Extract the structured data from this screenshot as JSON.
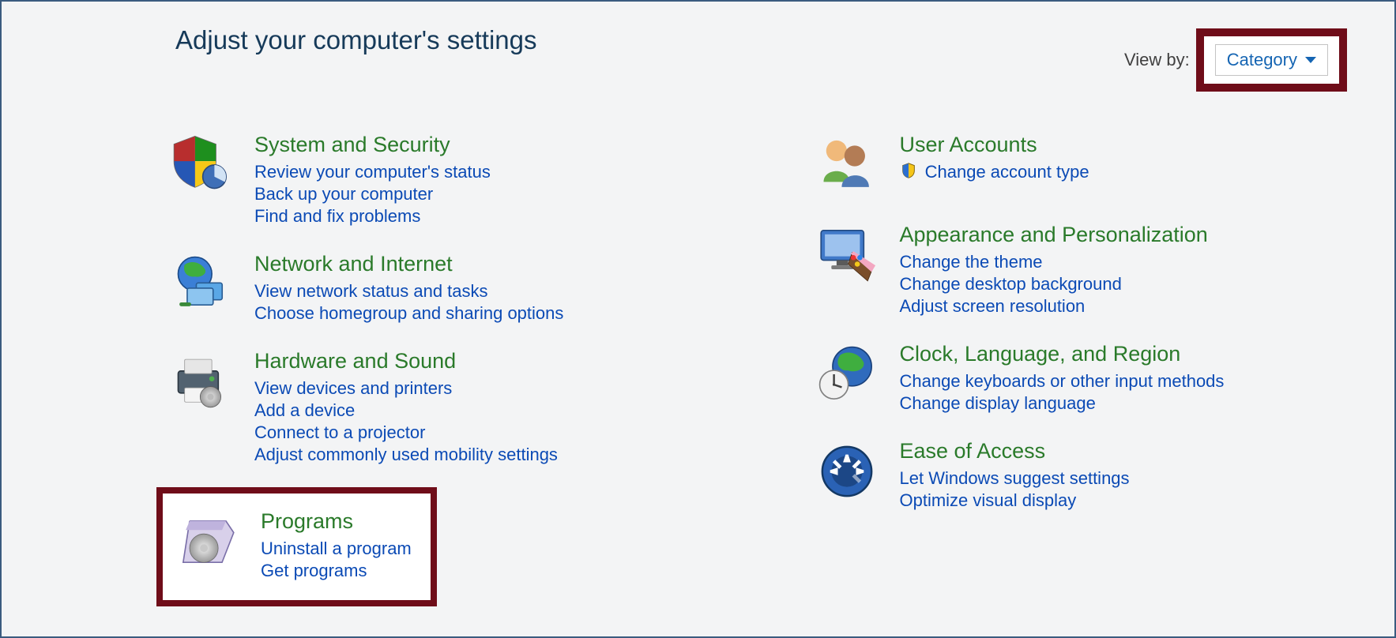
{
  "header": {
    "title": "Adjust your computer's settings",
    "view_by_label": "View by:",
    "view_by_value": "Category"
  },
  "left": {
    "system_security": {
      "title": "System and Security",
      "links": [
        "Review your computer's status",
        "Back up your computer",
        "Find and fix problems"
      ]
    },
    "network_internet": {
      "title": "Network and Internet",
      "links": [
        "View network status and tasks",
        "Choose homegroup and sharing options"
      ]
    },
    "hardware_sound": {
      "title": "Hardware and Sound",
      "links": [
        "View devices and printers",
        "Add a device",
        "Connect to a projector",
        "Adjust commonly used mobility settings"
      ]
    },
    "programs": {
      "title": "Programs",
      "links": [
        "Uninstall a program",
        "Get programs"
      ]
    }
  },
  "right": {
    "user_accounts": {
      "title": "User Accounts",
      "links": [
        "Change account type"
      ]
    },
    "appearance": {
      "title": "Appearance and Personalization",
      "links": [
        "Change the theme",
        "Change desktop background",
        "Adjust screen resolution"
      ]
    },
    "clock": {
      "title": "Clock, Language, and Region",
      "links": [
        "Change keyboards or other input methods",
        "Change display language"
      ]
    },
    "ease": {
      "title": "Ease of Access",
      "links": [
        "Let Windows suggest settings",
        "Optimize visual display"
      ]
    }
  }
}
